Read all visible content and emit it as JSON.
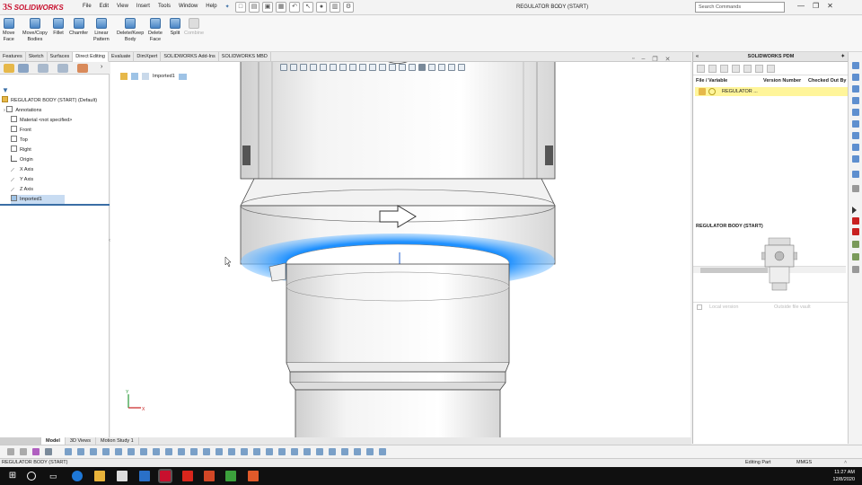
{
  "app": {
    "logo_text": "SOLIDWORKS",
    "document_title": "REGULATOR BODY (START)",
    "menus": [
      "File",
      "Edit",
      "View",
      "Insert",
      "Tools",
      "Window",
      "Help"
    ],
    "search_placeholder": "Search Commands"
  },
  "ribbon": {
    "buttons": [
      {
        "label": "Move\nFace",
        "icon": "move-face-icon"
      },
      {
        "label": "Move/Copy\nBodies",
        "icon": "move-copy-bodies-icon"
      },
      {
        "label": "Fillet",
        "icon": "fillet-icon"
      },
      {
        "label": "Chamfer",
        "icon": "chamfer-icon"
      },
      {
        "label": "Linear\nPattern",
        "icon": "linear-pattern-icon"
      },
      {
        "label": "Delete/Keep\nBody",
        "icon": "delete-keep-body-icon"
      },
      {
        "label": "Delete\nFace",
        "icon": "delete-face-icon"
      },
      {
        "label": "Split",
        "icon": "split-icon"
      },
      {
        "label": "Combine",
        "icon": "combine-icon",
        "disabled": true
      }
    ]
  },
  "command_tabs": [
    "Features",
    "Sketch",
    "Surfaces",
    "Direct Editing",
    "Evaluate",
    "DimXpert",
    "SOLIDWORKS Add-Ins",
    "SOLIDWORKS MBD"
  ],
  "active_command_tab": "Direct Editing",
  "feature_tree": {
    "root": "REGULATOR BODY (START)  (Default)",
    "items": [
      {
        "label": "Annotations",
        "icon": "annotations-icon"
      },
      {
        "label": "Material <not specified>",
        "icon": "material-icon"
      },
      {
        "label": "Front",
        "icon": "plane-icon"
      },
      {
        "label": "Top",
        "icon": "plane-icon"
      },
      {
        "label": "Right",
        "icon": "plane-icon"
      },
      {
        "label": "Origin",
        "icon": "origin-icon"
      },
      {
        "label": "X Axis",
        "icon": "axis-icon"
      },
      {
        "label": "Y Axis",
        "icon": "axis-icon"
      },
      {
        "label": "Z Axis",
        "icon": "axis-icon"
      },
      {
        "label": "Imported1",
        "icon": "imported-body-icon",
        "selected": true
      }
    ]
  },
  "viewport": {
    "breadcrumb": "Imported1"
  },
  "pdm": {
    "title": "SOLIDWORKS PDM",
    "columns": [
      "File / Variable",
      "Version Number",
      "Checked Out By"
    ],
    "row": "REGULATOR ...",
    "preview_title": "REGULATOR BODY (START)",
    "footer_left": "Local version",
    "footer_right": "Outside file vault"
  },
  "bottom_tabs": [
    "Model",
    "3D Views",
    "Motion Study 1"
  ],
  "active_bottom_tab": "Model",
  "status": {
    "left": "REGULATOR BODY (START)",
    "editing": "Editing Part",
    "units": "MMGS"
  },
  "clock": {
    "time": "11:27 AM",
    "date": "12/8/2020"
  },
  "colors": {
    "highlight": "#1e90ff",
    "brand": "#c8102e",
    "selected_row": "#fff59a"
  }
}
